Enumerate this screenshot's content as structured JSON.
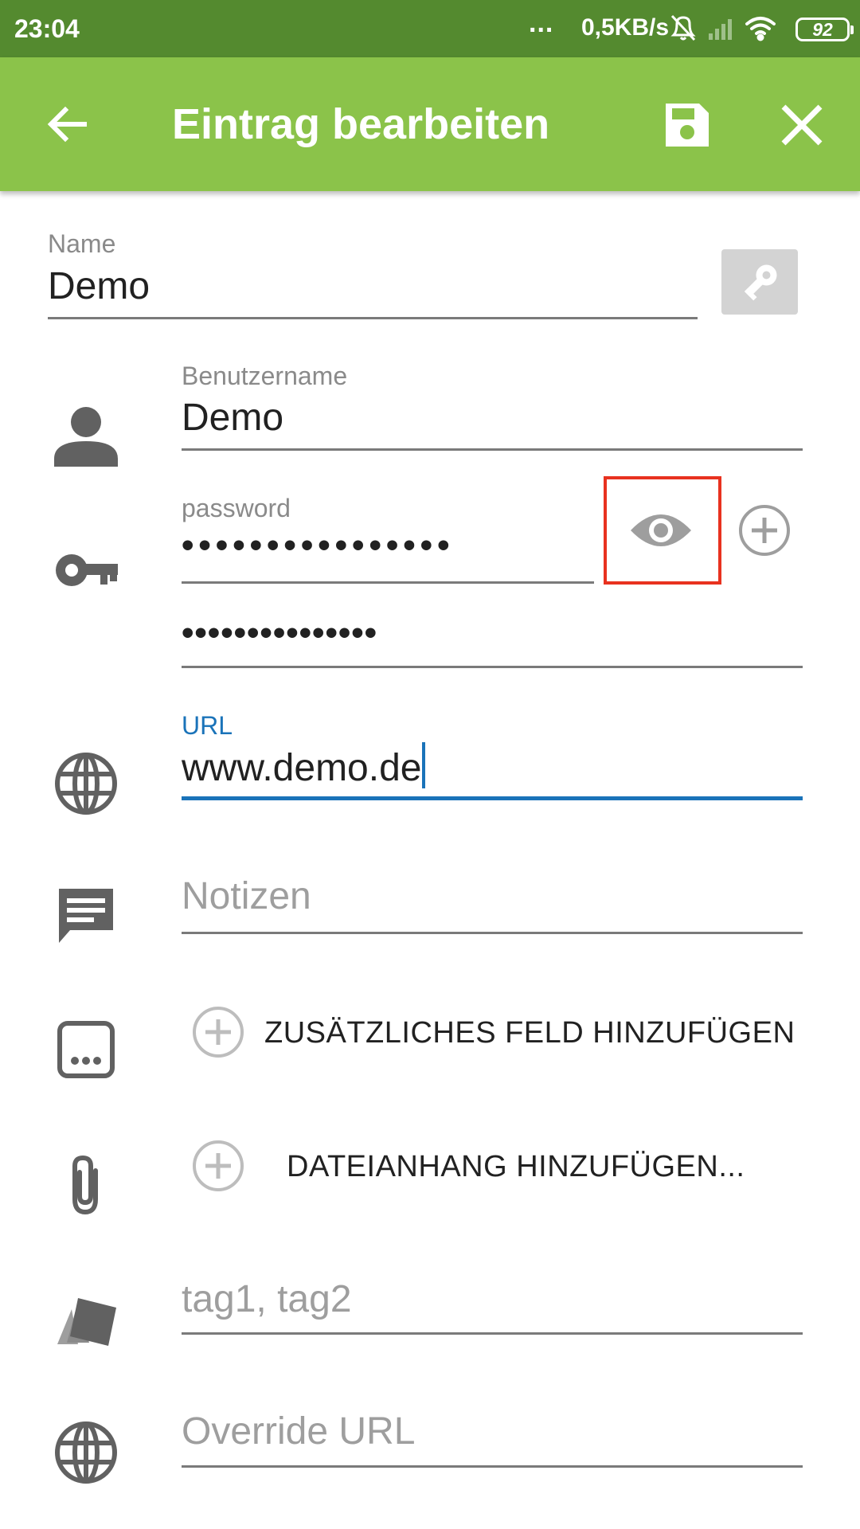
{
  "status_bar": {
    "time": "23:04",
    "dots": "...",
    "network_speed": "0,5KB/s",
    "battery": "92",
    "icons": [
      "mute-icon",
      "signal-icon",
      "wifi-icon",
      "battery-icon"
    ]
  },
  "app_bar": {
    "title": "Eintrag bearbeiten",
    "back_icon": "arrow-left-icon",
    "save_icon": "floppy-disk-icon",
    "close_icon": "close-icon"
  },
  "form": {
    "name": {
      "label": "Name",
      "value": "Demo"
    },
    "username": {
      "label": "Benutzername",
      "value": "Demo"
    },
    "password": {
      "label": "password",
      "masked_value": "••••••••••••••••",
      "confirm_masked_value": "•••••••••••••••"
    },
    "url": {
      "label": "URL",
      "value": "www.demo.de"
    },
    "notes": {
      "placeholder": "Notizen"
    },
    "add_field": {
      "label": "ZUSÄTZLICHES FELD HINZUFÜGEN"
    },
    "add_attachment": {
      "label": "DATEIANHANG HINZUFÜGEN..."
    },
    "tags": {
      "placeholder": "tag1, tag2"
    },
    "override_url": {
      "placeholder": "Override URL"
    }
  },
  "colors": {
    "status_bar": "#548a2f",
    "app_bar": "#8bc34a",
    "accent": "#1a73b9",
    "highlight": "#e8321f"
  }
}
